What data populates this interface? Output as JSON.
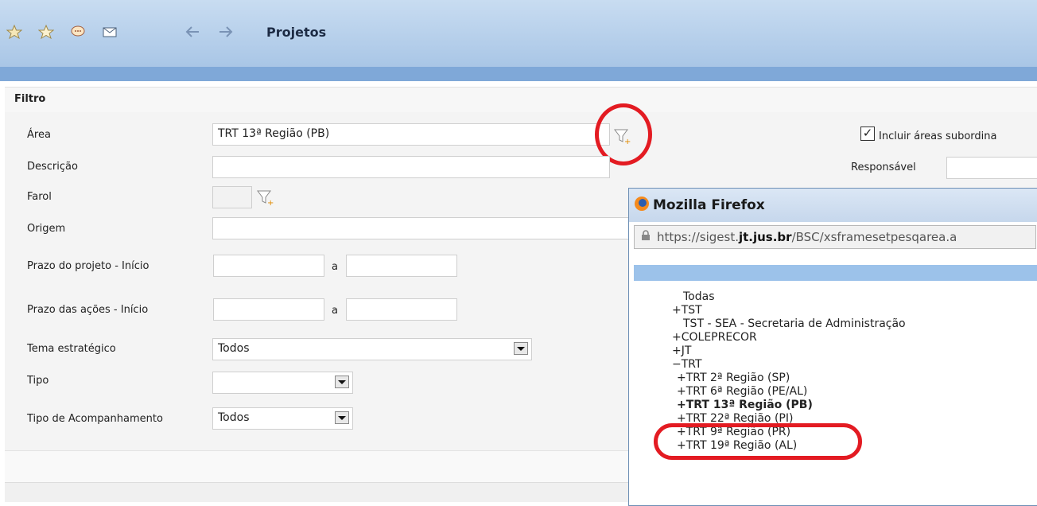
{
  "toolbar": {
    "title": "Projetos"
  },
  "filter": {
    "header": "Filtro",
    "area_label": "Área",
    "area_value": "TRT 13ª Região (PB)",
    "include_label": "Incluir áreas subordina",
    "responsavel_label": "Responsável",
    "descricao_label": "Descrição",
    "farol_label": "Farol",
    "origem_label": "Origem",
    "prazo_projeto_label": "Prazo do projeto - Início",
    "prazo_acoes_label": "Prazo das ações - Início",
    "a_label": "a",
    "tema_label": "Tema estratégico",
    "tema_value": "Todos",
    "tipo_label": "Tipo",
    "tipo_value": "",
    "acompanhamento_label": "Tipo de Acompanhamento",
    "acompanhamento_value": "Todos"
  },
  "popup": {
    "title": "Mozilla Firefox",
    "url_prefix": "https://sigest.",
    "url_domain": "jt.jus.br",
    "url_suffix": "/BSC/xsframesetpesqarea.a",
    "tree": [
      "Todas",
      "+TST",
      "TST - SEA - Secretaria de Administração",
      "+COLEPRECOR",
      "+JT",
      "−TRT",
      "+TRT 2ª Região (SP)",
      "+TRT 6ª Região (PE/AL)",
      "+TRT 13ª Região (PB)",
      "+TRT 22ª Região (PI)",
      "+TRT 9ª Região (PR)",
      "+TRT 19ª Região (AL)"
    ]
  },
  "colors": {
    "annotation": "#e31b22",
    "header_blue": "#a9c6e6"
  }
}
